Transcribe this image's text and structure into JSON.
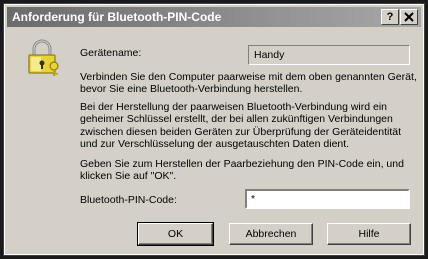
{
  "window": {
    "title": "Anforderung für Bluetooth-PIN-Code",
    "help_button": "?",
    "close_button": "X"
  },
  "icon": {
    "name": "padlock-key-icon"
  },
  "device": {
    "label": "Gerätename:",
    "value": "Handy"
  },
  "texts": {
    "paragraph1": "Verbinden Sie den Computer paarweise mit dem oben genannten Gerät, bevor Sie eine Bluetooth-Verbindung herstellen.",
    "paragraph2": "Bei der Herstellung der paarweisen Bluetooth-Verbindung wird ein geheimer Schlüssel erstellt, der bei allen zukünftigen Verbindungen zwischen diesen beiden Geräten zur Überprüfung der Geräteidentität und zur Verschlüsselung der ausgetauschten Daten dient.",
    "paragraph3": "Geben Sie zum Herstellen der Paarbeziehung den PIN-Code ein, und klicken Sie auf \"OK\"."
  },
  "pin": {
    "label": "Bluetooth-PIN-Code:",
    "value": "*"
  },
  "buttons": {
    "ok": "OK",
    "cancel": "Abbrechen",
    "help": "Hilfe"
  }
}
